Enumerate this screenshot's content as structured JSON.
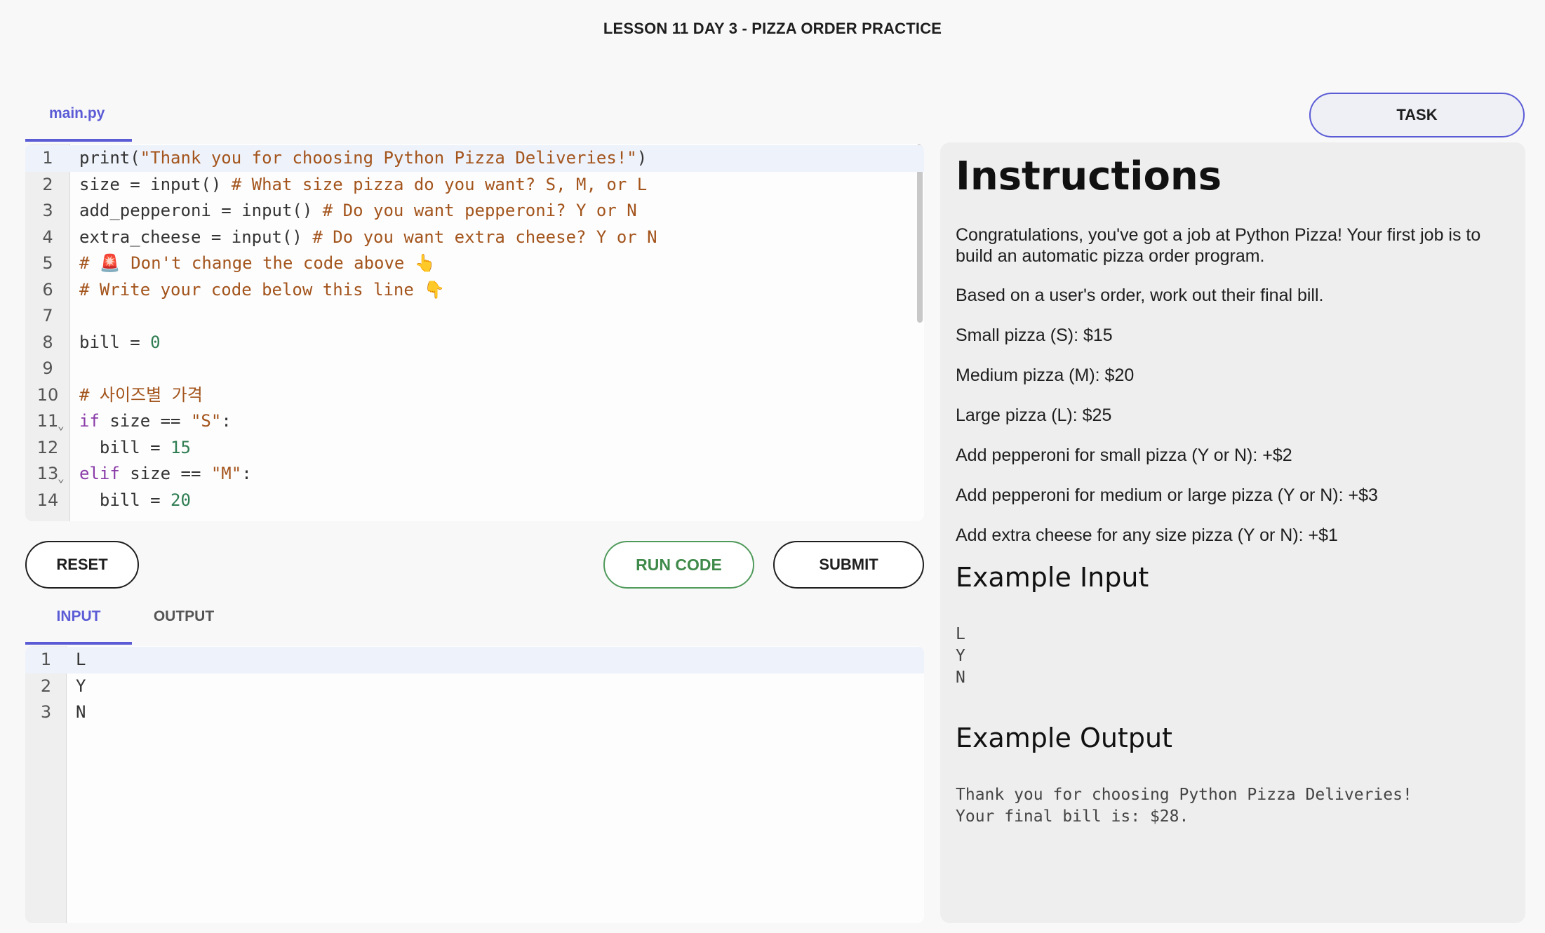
{
  "page": {
    "title": "LESSON 11 DAY 3 - PIZZA ORDER PRACTICE"
  },
  "editor": {
    "file_tab": "main.py",
    "lines": [
      {
        "n": "1",
        "parts": [
          [
            "",
            "print("
          ],
          [
            "str",
            "\"Thank you for choosing Python Pizza Deliveries!\""
          ],
          [
            "",
            ")"
          ]
        ]
      },
      {
        "n": "2",
        "parts": [
          [
            "",
            "size = input() "
          ],
          [
            "com",
            "# What size pizza do you want? S, M, or L"
          ]
        ]
      },
      {
        "n": "3",
        "parts": [
          [
            "",
            "add_pepperoni = input() "
          ],
          [
            "com",
            "# Do you want pepperoni? Y or N"
          ]
        ]
      },
      {
        "n": "4",
        "parts": [
          [
            "",
            "extra_cheese = input() "
          ],
          [
            "com",
            "# Do you want extra cheese? Y or N"
          ]
        ]
      },
      {
        "n": "5",
        "parts": [
          [
            "com",
            "# 🚨 Don't change the code above 👆"
          ]
        ]
      },
      {
        "n": "6",
        "parts": [
          [
            "com",
            "# Write your code below this line 👇"
          ]
        ]
      },
      {
        "n": "7",
        "parts": []
      },
      {
        "n": "8",
        "parts": [
          [
            "",
            "bill = "
          ],
          [
            "num",
            "0"
          ]
        ]
      },
      {
        "n": "9",
        "parts": []
      },
      {
        "n": "10",
        "parts": [
          [
            "com",
            "# 사이즈별 가격"
          ]
        ]
      },
      {
        "n": "11",
        "fold": true,
        "parts": [
          [
            "kw",
            "if"
          ],
          [
            "",
            " size == "
          ],
          [
            "str",
            "\"S\""
          ],
          [
            "",
            ":"
          ]
        ]
      },
      {
        "n": "12",
        "parts": [
          [
            "",
            "  bill = "
          ],
          [
            "num",
            "15"
          ]
        ]
      },
      {
        "n": "13",
        "fold": true,
        "parts": [
          [
            "kw",
            "elif"
          ],
          [
            "",
            " size == "
          ],
          [
            "str",
            "\"M\""
          ],
          [
            "",
            ":"
          ]
        ]
      },
      {
        "n": "14",
        "parts": [
          [
            "",
            "  bill = "
          ],
          [
            "num",
            "20"
          ]
        ]
      }
    ]
  },
  "buttons": {
    "reset": "RESET",
    "run": "RUN CODE",
    "submit": "SUBMIT",
    "task": "TASK"
  },
  "io_tabs": {
    "input": "INPUT",
    "output": "OUTPUT"
  },
  "input_editor": {
    "lines": [
      {
        "n": "1",
        "text": "L"
      },
      {
        "n": "2",
        "text": "Y"
      },
      {
        "n": "3",
        "text": "N"
      }
    ]
  },
  "instructions": {
    "heading": "Instructions",
    "intro": "Congratulations, you've got a job at Python Pizza! Your first job is to build an automatic pizza order program.",
    "bill_note": "Based on a user's order, work out their final bill.",
    "prices": [
      "Small pizza (S): $15",
      "Medium pizza (M): $20",
      "Large pizza (L): $25",
      "Add pepperoni for small pizza (Y or N): +$2",
      "Add pepperoni for medium or large pizza (Y or N): +$3",
      "Add extra cheese for any size pizza (Y or N): +$1"
    ],
    "example_input_title": "Example Input",
    "example_input": "L\nY\nN",
    "example_output_title": "Example Output",
    "example_output": "Thank you for choosing Python Pizza Deliveries!\nYour final bill is: $28."
  },
  "colors": {
    "accent": "#5b5bd6",
    "run_green": "#3f8a4a",
    "string": "#a3541c",
    "keyword": "#8a3ca8",
    "number": "#2f7d52"
  }
}
